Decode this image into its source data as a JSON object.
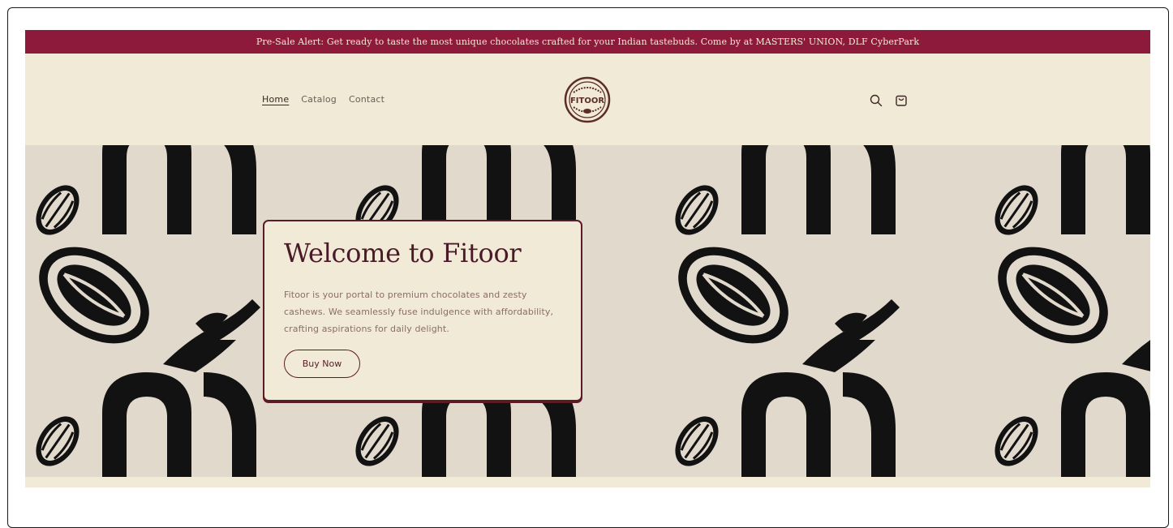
{
  "announcement": {
    "text": "Pre-Sale Alert: Get ready to taste the most unique chocolates crafted for your Indian tastebuds. Come by at MASTERS' UNION, DLF CyberPark"
  },
  "header": {
    "nav": [
      {
        "label": "Home",
        "active": true
      },
      {
        "label": "Catalog",
        "active": false
      },
      {
        "label": "Contact",
        "active": false
      }
    ],
    "logo_text": "FITOOR",
    "icons": [
      "search-icon",
      "cart-icon"
    ]
  },
  "hero": {
    "title": "Welcome to Fitoor",
    "description": "Fitoor is your portal to premium chocolates and zesty cashews. We seamlessly fuse indulgence with affordability, crafting aspirations for daily delight.",
    "cta_label": "Buy Now"
  },
  "colors": {
    "announcement_bg": "#8e1a3b",
    "header_bg": "#f1ead6",
    "hero_bg": "#e2d9cd",
    "accent": "#5a1a28"
  }
}
